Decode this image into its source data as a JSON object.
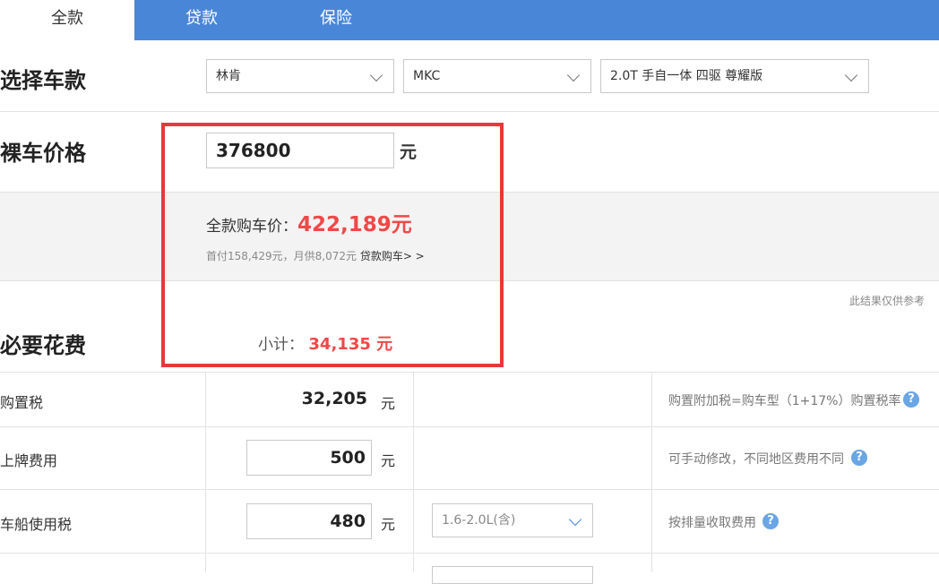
{
  "tabs": [
    {
      "label": "全款"
    },
    {
      "label": "贷款"
    },
    {
      "label": "保险"
    }
  ],
  "select_model": {
    "title": "选择车款",
    "brand": "林肯",
    "series": "MKC",
    "variant": "2.0T 手自一体 四驱 尊耀版"
  },
  "bare_price": {
    "title": "裸车价格",
    "value": "376800",
    "unit": "元"
  },
  "summary": {
    "full_price_label": "全款购车价：",
    "full_price_value": "422,189元",
    "loan_info": "首付158,429元，月供8,072元",
    "loan_link": "贷款购车> >"
  },
  "disclaimer": "此结果仅供参考",
  "necessary": {
    "title": "必要花费",
    "subtotal_label": "小计：",
    "subtotal_value": "34,135 元"
  },
  "rows": [
    {
      "label": "购置税",
      "value": "32,205",
      "unit": "元",
      "note": "购置附加税=购车型（1+17%）购置税率"
    },
    {
      "label": "上牌费用",
      "value": "500",
      "unit": "元",
      "note": "可手动修改，不同地区费用不同"
    },
    {
      "label": "车船使用税",
      "value": "480",
      "unit": "元",
      "option": "1.6-2.0L(含)",
      "note": "按排量收取费用"
    }
  ],
  "colors": {
    "tab_bar": "#4a86d8",
    "highlight_red": "#e63939",
    "price_red": "#f04848",
    "help_blue": "#6aa5e4"
  }
}
